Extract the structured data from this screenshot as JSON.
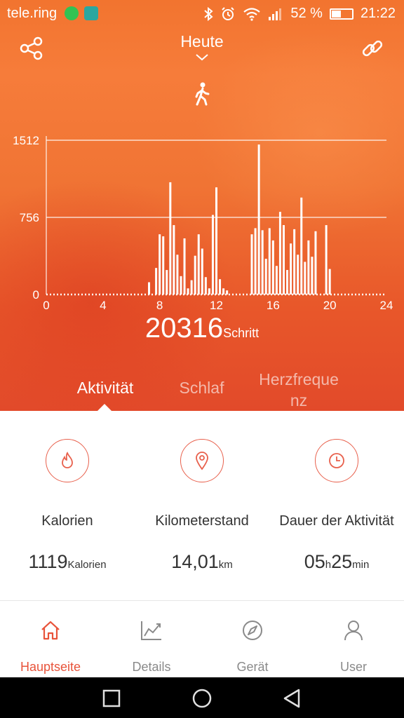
{
  "status_bar": {
    "carrier": "tele.ring",
    "battery": "52 %",
    "time": "21:22"
  },
  "header": {
    "title": "Heute",
    "activity_icon": "walking-person-icon"
  },
  "chart_data": {
    "type": "bar",
    "x": [
      7.25,
      7.75,
      8.0,
      8.25,
      8.5,
      8.75,
      9.0,
      9.25,
      9.5,
      9.75,
      10.0,
      10.25,
      10.5,
      10.75,
      11.0,
      11.25,
      11.5,
      11.75,
      12.0,
      12.25,
      12.5,
      12.75,
      14.5,
      14.75,
      15.0,
      15.25,
      15.5,
      15.75,
      16.0,
      16.25,
      16.5,
      16.75,
      17.0,
      17.25,
      17.5,
      17.75,
      18.0,
      18.25,
      18.5,
      18.75,
      19.0,
      19.75,
      20.0
    ],
    "values": [
      120,
      260,
      590,
      570,
      240,
      1100,
      680,
      390,
      180,
      550,
      60,
      140,
      380,
      590,
      450,
      170,
      60,
      780,
      1050,
      150,
      60,
      40,
      590,
      650,
      1470,
      630,
      350,
      650,
      530,
      280,
      810,
      680,
      240,
      500,
      640,
      390,
      950,
      320,
      530,
      370,
      620,
      680,
      250
    ],
    "xlim": [
      0,
      24
    ],
    "ylim": [
      0,
      1512
    ],
    "xticks": [
      "0",
      "4",
      "8",
      "12",
      "16",
      "20",
      "24"
    ],
    "yticks": [
      "1512",
      "756",
      "0"
    ],
    "grid": true
  },
  "steps": {
    "value": "20316",
    "unit": "Schritt"
  },
  "tabs": [
    {
      "label": "Aktivität",
      "active": true
    },
    {
      "label": "Schlaf",
      "active": false
    },
    {
      "label_line1": "Herzfreque",
      "label_line2": "nz",
      "active": false
    }
  ],
  "stats": [
    {
      "icon": "flame-icon",
      "label": "Kalorien",
      "value": "1119",
      "unit": "Kalorien"
    },
    {
      "icon": "location-pin-icon",
      "label": "Kilometerstand",
      "value": "14,01",
      "unit": "km"
    },
    {
      "icon": "clock-icon",
      "label": "Dauer der Aktivität",
      "value_h": "05",
      "unit_h": "h",
      "value_m": "25",
      "unit_m": "min"
    }
  ],
  "nav": [
    {
      "label": "Hauptseite",
      "icon": "home-icon",
      "active": true
    },
    {
      "label": "Details",
      "icon": "trend-chart-icon",
      "active": false
    },
    {
      "label": "Gerät",
      "icon": "compass-icon",
      "active": false
    },
    {
      "label": "User",
      "icon": "user-icon",
      "active": false
    }
  ],
  "colors": {
    "accent": "#e8533a",
    "hero": "#f2742f"
  }
}
